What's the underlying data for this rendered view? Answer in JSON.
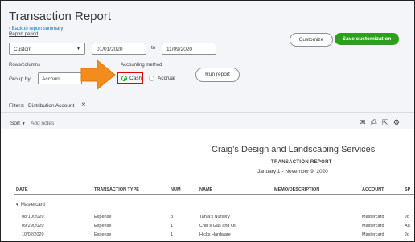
{
  "header": {
    "title": "Transaction Report",
    "back_link": "Back to report summary",
    "customize_label": "Customize",
    "save_label": "Save customization"
  },
  "period": {
    "label": "Report period",
    "selected": "Custom",
    "from_date": "01/01/2020",
    "to_label": "to",
    "to_date": "11/09/2020"
  },
  "rows_columns": {
    "label": "Rows/columns",
    "group_by_label": "Group by",
    "group_by_value": "Account"
  },
  "accounting_method": {
    "label": "Accounting method",
    "options": [
      "Cash",
      "Accrual"
    ],
    "selected": "Cash"
  },
  "run_report_label": "Run report",
  "filters": {
    "label": "Filters:",
    "value": "Distribution Account"
  },
  "toolbar": {
    "sort_label": "Sort",
    "add_notes_label": "Add notes"
  },
  "report": {
    "company": "Craig's Design and Landscaping Services",
    "title": "TRANSACTION REPORT",
    "date_range": "January 1 - November 9, 2020",
    "columns": [
      "DATE",
      "TRANSACTION TYPE",
      "NUM",
      "NAME",
      "MEMO/DESCRIPTION",
      "ACCOUNT",
      "SP"
    ],
    "group": "Mastercard",
    "rows": [
      {
        "date": "08/10/2020",
        "type": "Expense",
        "num": "3",
        "name": "Tania's Nursery",
        "memo": "",
        "account": "Mastercard",
        "split": "Jo"
      },
      {
        "date": "09/29/2020",
        "type": "Expense",
        "num": "1",
        "name": "Chin's Gas and Oil",
        "memo": "",
        "account": "Mastercard",
        "split": "Au"
      },
      {
        "date": "10/02/2020",
        "type": "Expense",
        "num": "1",
        "name": "Hicks Hardware",
        "memo": "",
        "account": "Mastercard",
        "split": "Jo"
      }
    ]
  },
  "colors": {
    "accent_green": "#2ca01c",
    "link_blue": "#0077c5",
    "highlight_red": "#e00000",
    "arrow_orange": "#f28c1c"
  }
}
